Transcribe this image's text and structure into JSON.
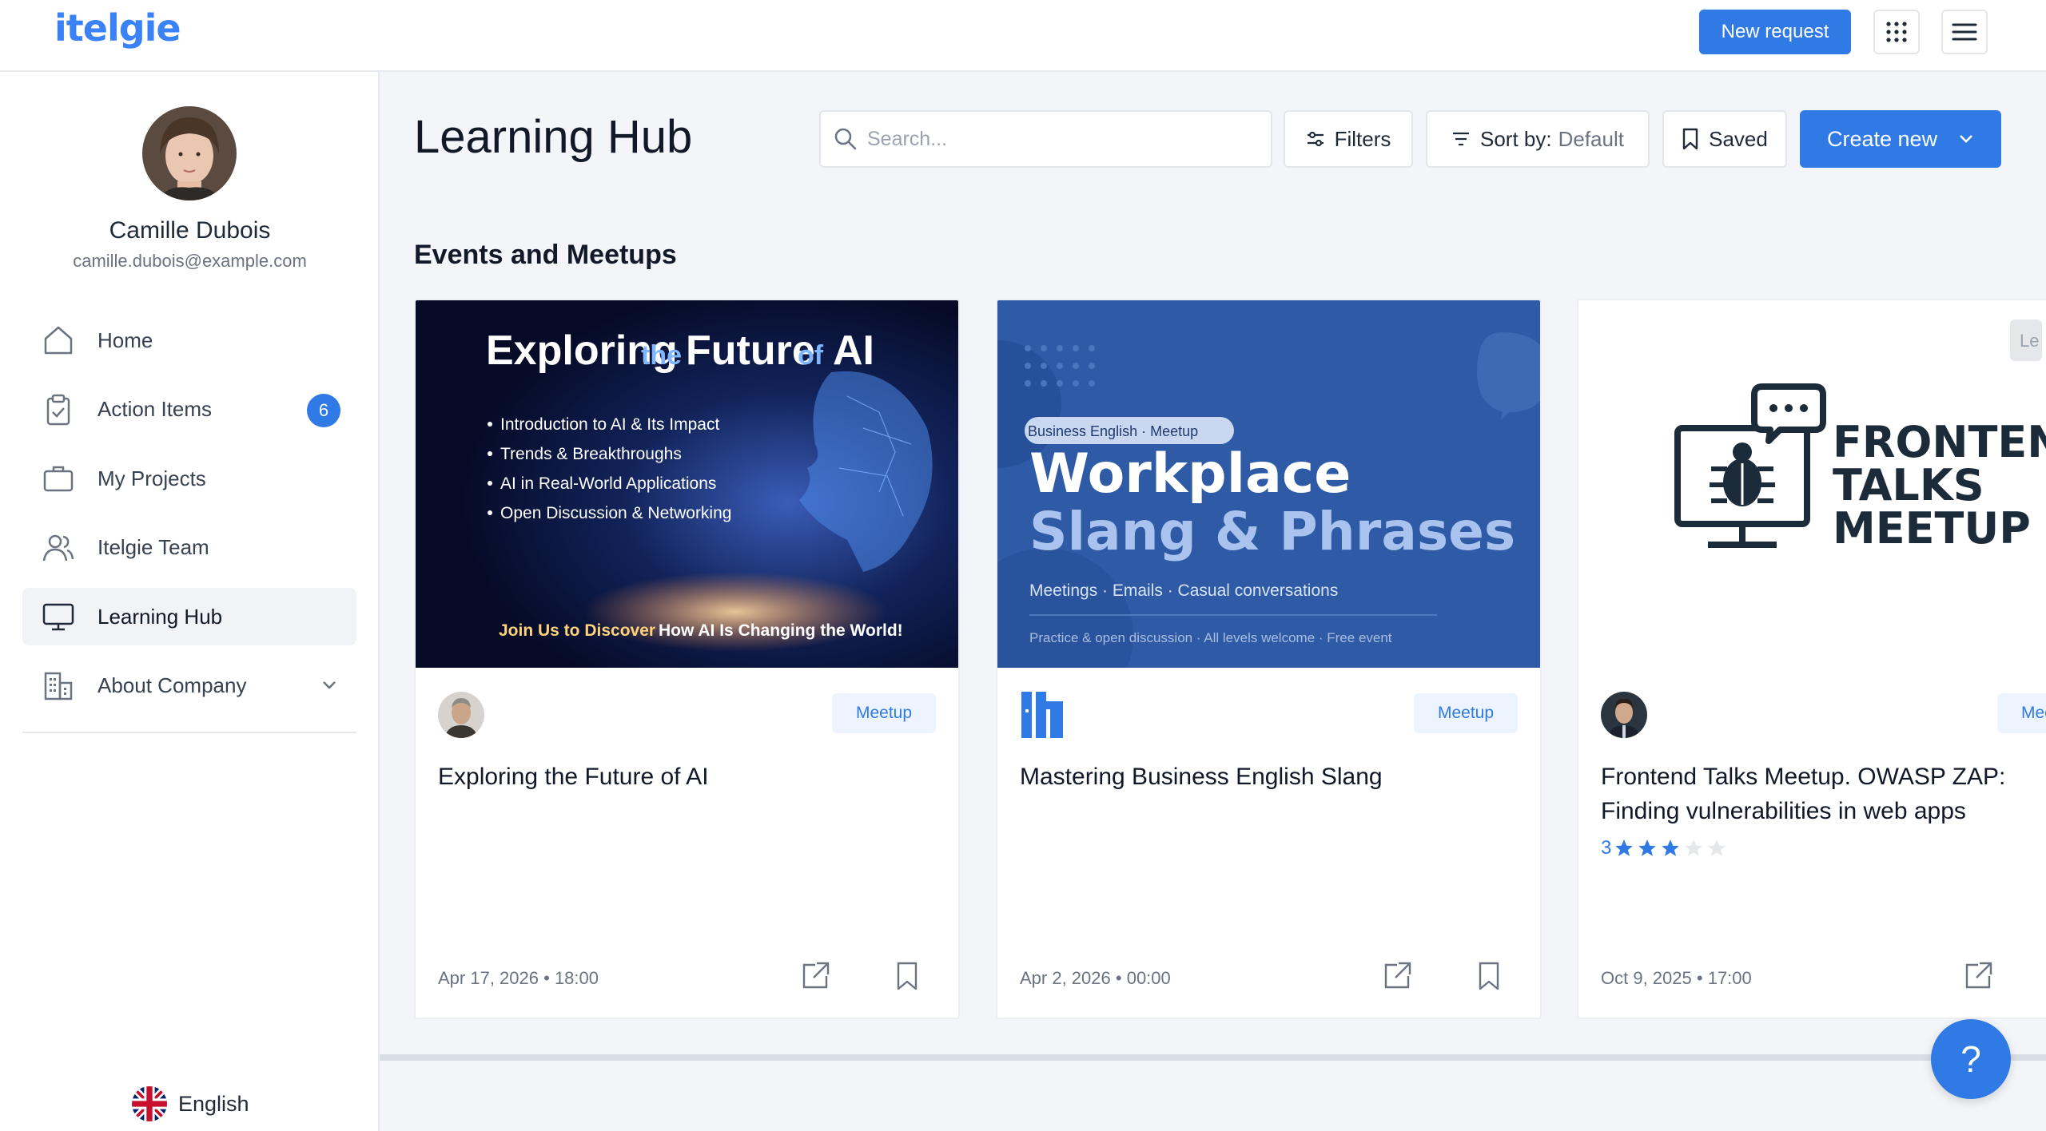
{
  "app": {
    "logo": "itelgie",
    "new_request_label": "New request"
  },
  "user": {
    "name": "Camille Dubois",
    "email": "camille.dubois@example.com"
  },
  "sidebar": {
    "items": [
      {
        "label": "Home",
        "icon": "home-icon"
      },
      {
        "label": "Action Items",
        "icon": "clipboard-check-icon",
        "badge": "6"
      },
      {
        "label": "My Projects",
        "icon": "briefcase-icon"
      },
      {
        "label": "Itelgie Team",
        "icon": "users-icon"
      },
      {
        "label": "Learning Hub",
        "icon": "monitor-icon",
        "active": true
      },
      {
        "label": "About Company",
        "icon": "building-icon",
        "expandable": true
      }
    ],
    "language": "English"
  },
  "main": {
    "title": "Learning Hub",
    "search_placeholder": "Search...",
    "filters_label": "Filters",
    "sort_label": "Sort by:",
    "sort_value": "Default",
    "saved_label": "Saved",
    "create_label": "Create new",
    "section_title": "Events and Meetups"
  },
  "cards": [
    {
      "title": "Exploring the Future of AI",
      "tag": "Meetup",
      "date": "Apr 17, 2026",
      "time": "18:00",
      "banner": {
        "heading_a": "Exploring",
        "heading_b": "the",
        "heading_c": "Future",
        "heading_d": "of",
        "heading_e": "AI",
        "bullets": [
          "Introduction to AI & Its Impact",
          "Trends & Breakthroughs",
          "AI in Real-World Applications",
          "Open Discussion & Networking"
        ],
        "footer_a": "Join Us to Discover",
        "footer_b": "How AI Is Changing the World!"
      }
    },
    {
      "title": "Mastering Business English Slang",
      "tag": "Meetup",
      "date": "Apr 2, 2026",
      "time": "00:00",
      "banner": {
        "chip": "Business English · Meetup",
        "line1": "Workplace",
        "line2": "Slang & Phrases",
        "sub": "Meetings · Emails · Casual conversations",
        "footer": "Practice & open discussion · All levels welcome · Free event"
      }
    },
    {
      "title": "Frontend Talks Meetup. OWASP ZAP: Finding vulnerabilities in web apps",
      "tag": "Meetup",
      "date": "Oct 9, 2025",
      "time": "17:00",
      "rating": "3",
      "rating_value": 3,
      "rating_max": 5,
      "corner_label": "Le",
      "banner": {
        "line1": "FRONTEND",
        "line2": "TALKS",
        "line3": "MEETUP"
      }
    }
  ],
  "colors": {
    "accent": "#2f7ae5",
    "logo": "#3b82f6"
  },
  "help_label": "?"
}
